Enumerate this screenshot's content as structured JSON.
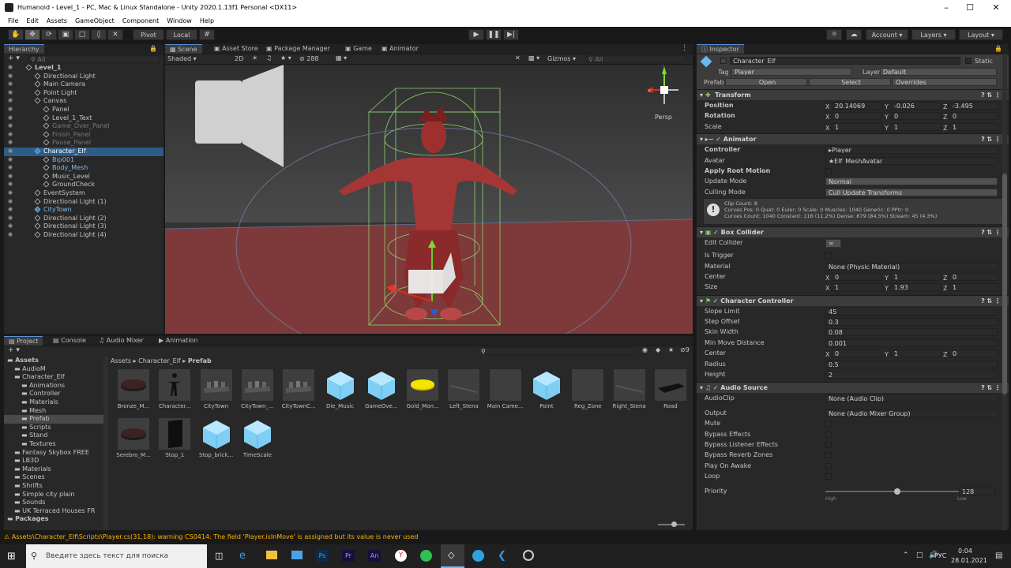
{
  "window": {
    "title": "Humanoid - Level_1 - PC, Mac & Linux Standalone - Unity 2020.1.13f1 Personal <DX11>"
  },
  "menu": [
    "File",
    "Edit",
    "Assets",
    "GameObject",
    "Component",
    "Window",
    "Help"
  ],
  "toolbar": {
    "pivot": "Pivot",
    "local": "Local",
    "account": "Account",
    "layers": "Layers",
    "layout": "Layout"
  },
  "hierarchy": {
    "tab": "Hierarchy",
    "search_placeholder": "All",
    "items": [
      {
        "label": "Level_1",
        "indent": 0
      },
      {
        "label": "Directional Light",
        "indent": 1
      },
      {
        "label": "Main Camera",
        "indent": 1
      },
      {
        "label": "Point Light",
        "indent": 1
      },
      {
        "label": "Canvas",
        "indent": 1
      },
      {
        "label": "Panel",
        "indent": 2
      },
      {
        "label": "Level_1_Text",
        "indent": 2
      },
      {
        "label": "Game_Over_Panel",
        "indent": 2
      },
      {
        "label": "Finish_Panel",
        "indent": 2
      },
      {
        "label": "Pause_Panel",
        "indent": 2
      },
      {
        "label": "Character_Elf",
        "indent": 1
      },
      {
        "label": "Bip001",
        "indent": 2
      },
      {
        "label": "Body_Mesh",
        "indent": 2
      },
      {
        "label": "Music_Level",
        "indent": 2
      },
      {
        "label": "GroundCheck",
        "indent": 2
      },
      {
        "label": "EventSystem",
        "indent": 1
      },
      {
        "label": "Directional Light (1)",
        "indent": 1
      },
      {
        "label": "CityTown",
        "indent": 1
      },
      {
        "label": "Directional Light (2)",
        "indent": 1
      },
      {
        "label": "Directional Light (3)",
        "indent": 1
      },
      {
        "label": "Directional Light (4)",
        "indent": 1
      }
    ]
  },
  "scene": {
    "tabs": [
      "Scene",
      "Asset Store",
      "Package Manager",
      "Game",
      "Animator"
    ],
    "shading": "Shaded",
    "mode_2d": "2D",
    "hidden_count": "288",
    "gizmos": "Gizmos",
    "search_placeholder": "All",
    "persp": "Persp"
  },
  "project": {
    "tabs": [
      "Project",
      "Console",
      "Audio Mixer",
      "Animation"
    ],
    "breadcrumb": [
      "Assets",
      "Character_Elf",
      "Prefab"
    ],
    "badge_count": "9",
    "tree": [
      {
        "label": "Assets",
        "indent": 0
      },
      {
        "label": "AudioM",
        "indent": 1
      },
      {
        "label": "Character_Elf",
        "indent": 1
      },
      {
        "label": "Animations",
        "indent": 2
      },
      {
        "label": "Controller",
        "indent": 2
      },
      {
        "label": "Materials",
        "indent": 2
      },
      {
        "label": "Mesh",
        "indent": 2
      },
      {
        "label": "Prefab",
        "indent": 2
      },
      {
        "label": "Scripts",
        "indent": 2
      },
      {
        "label": "Stand",
        "indent": 2
      },
      {
        "label": "Textures",
        "indent": 2
      },
      {
        "label": "Fantasy Skybox FREE",
        "indent": 1
      },
      {
        "label": "LB3D",
        "indent": 1
      },
      {
        "label": "Materials",
        "indent": 1
      },
      {
        "label": "Scenes",
        "indent": 1
      },
      {
        "label": "Shrifts",
        "indent": 1
      },
      {
        "label": "Simple city plain",
        "indent": 1
      },
      {
        "label": "Sounds",
        "indent": 1
      },
      {
        "label": "UK Terraced Houses FR",
        "indent": 1
      },
      {
        "label": "Packages",
        "indent": 0
      }
    ],
    "assets": [
      "Bronze_M...",
      "Character...",
      "CityTown",
      "CityTown_...",
      "CityTownC...",
      "Die_Music",
      "GameOve...",
      "Gold_Mon...",
      "Left_Stena",
      "Main Came...",
      "Point",
      "Reg_Zone",
      "Right_Stena",
      "Road",
      "Serebro_M...",
      "Stop_1",
      "Stop_brick...",
      "TimeScale"
    ]
  },
  "inspector": {
    "tab": "Inspector",
    "name": "Character_Elf",
    "static": "Static",
    "tag_label": "Tag",
    "tag": "Player",
    "layer_label": "Layer",
    "layer": "Default",
    "prefab_label": "Prefab",
    "open": "Open",
    "select": "Select",
    "overrides": "Overrides",
    "transform": {
      "title": "Transform",
      "position_label": "Position",
      "rotation_label": "Rotation",
      "scale_label": "Scale",
      "pos": [
        "20.14069",
        "-0.026",
        "-3.495"
      ],
      "rot": [
        "0",
        "0",
        "0"
      ],
      "scale": [
        "1",
        "1",
        "1"
      ]
    },
    "animator": {
      "title": "Animator",
      "controller_label": "Controller",
      "controller": "Player",
      "avatar_label": "Avatar",
      "avatar": "Elf_MeshAvatar",
      "root_motion": "Apply Root Motion",
      "update_label": "Update Mode",
      "update": "Normal",
      "culling_label": "Culling Mode",
      "culling": "Cull Update Transforms",
      "info1": "Clip Count: 8",
      "info2": "Curves Pos: 0 Quat: 0 Euler: 0 Scale: 0 Muscles: 1040 Generic: 0 PPtr: 0",
      "info3": "Curves Count: 1040 Constant: 116 (11.2%) Dense: 879 (84.5%) Stream: 45 (4.3%)"
    },
    "box": {
      "title": "Box Collider",
      "edit": "Edit Collider",
      "trigger": "Is Trigger",
      "material_label": "Material",
      "material": "None (Physic Material)",
      "center_label": "Center",
      "size_label": "Size",
      "center": [
        "0",
        "1",
        "0"
      ],
      "size": [
        "1",
        "1.93",
        "1"
      ]
    },
    "cc": {
      "title": "Character Controller",
      "slope_label": "Slope Limit",
      "slope": "45",
      "step_label": "Step Offset",
      "step": "0.3",
      "skin_label": "Skin Width",
      "skin": "0.08",
      "min_label": "Min Move Distance",
      "min": "0.001",
      "center_label": "Center",
      "center": [
        "0",
        "1",
        "0"
      ],
      "radius_label": "Radius",
      "radius": "0.5",
      "height_label": "Height",
      "height": "2"
    },
    "audio": {
      "title": "Audio Source",
      "clip_label": "AudioClip",
      "clip": "None (Audio Clip)",
      "output_label": "Output",
      "output": "None (Audio Mixer Group)",
      "mute": "Mute",
      "bypass": "Bypass Effects",
      "bypass_listener": "Bypass Listener Effects",
      "bypass_reverb": "Bypass Reverb Zones",
      "play": "Play On Awake",
      "loop": "Loop",
      "priority_label": "Priority",
      "priority": "128",
      "high": "High",
      "low": "Low"
    }
  },
  "status": {
    "message": "Assets\\Character_Elf\\Scripts\\Player.cs(31,18): warning CS0414: The field 'Player.isInMove' is assigned but its value is never used"
  },
  "taskbar": {
    "search_placeholder": "Введите здесь текст для поиска",
    "lang": "РУС",
    "time": "0:04",
    "date": "28.01.2021"
  }
}
